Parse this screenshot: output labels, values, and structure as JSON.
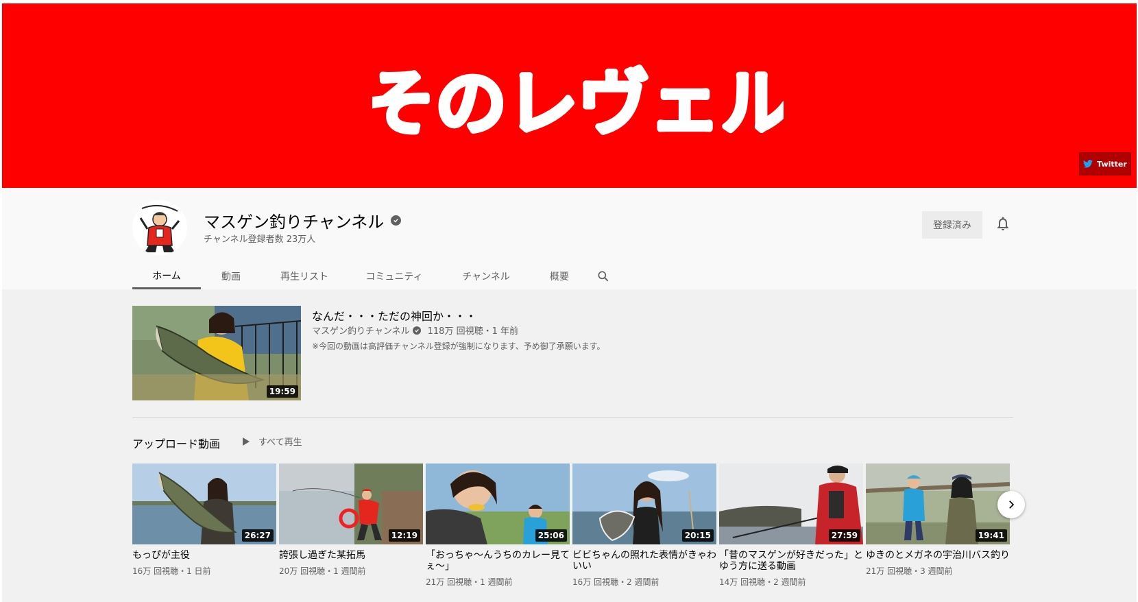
{
  "banner": {
    "logo_text": "そのレヴェル",
    "twitter_label": "Twitter",
    "color": "#ff0000"
  },
  "channel": {
    "name": "マスゲン釣りチャンネル",
    "subscriber_text": "チャンネル登録者数 23万人",
    "subscribed_label": "登録済み"
  },
  "tabs": [
    {
      "label": "ホーム",
      "active": true
    },
    {
      "label": "動画"
    },
    {
      "label": "再生リスト"
    },
    {
      "label": "コミュニティ"
    },
    {
      "label": "チャンネル"
    },
    {
      "label": "概要"
    }
  ],
  "featured": {
    "title": "なんだ・・・ただの神回か・・・",
    "channel": "マスゲン釣りチャンネル",
    "stats": "118万 回視聴・1 年前",
    "description": "※今回の動画は高評価チャンネル登録が強制になります、予め御了承願います。",
    "duration": "19:59"
  },
  "uploads": {
    "title": "アップロード動画",
    "play_all_label": "すべて再生",
    "videos": [
      {
        "title": "もっぴが主役",
        "meta": "16万 回視聴・1 日前",
        "duration": "26:27"
      },
      {
        "title": "誇張し過ぎた某拓馬",
        "meta": "20万 回視聴・1 週間前",
        "duration": "12:19"
      },
      {
        "title": "「おっちゃ～んうちのカレー見てぇ～」",
        "meta": "21万 回視聴・1 週間前",
        "duration": "25:06"
      },
      {
        "title": "ビビちゃんの照れた表情がきゃわいい",
        "meta": "16万 回視聴・2 週間前",
        "duration": "20:15"
      },
      {
        "title": "「昔のマスゲンが好きだった」とゆう方に送る動画",
        "meta": "14万 回視聴・2 週間前",
        "duration": "27:59"
      },
      {
        "title": "ゆきのとメガネの宇治川バス釣り",
        "meta": "21万 回視聴・3 週間前",
        "duration": "19:41"
      }
    ]
  },
  "icons": {
    "verified": "verified-icon",
    "bell": "bell-icon",
    "search": "search-icon",
    "play": "play-icon",
    "next": "chevron-right-icon",
    "twitter": "twitter-icon"
  }
}
